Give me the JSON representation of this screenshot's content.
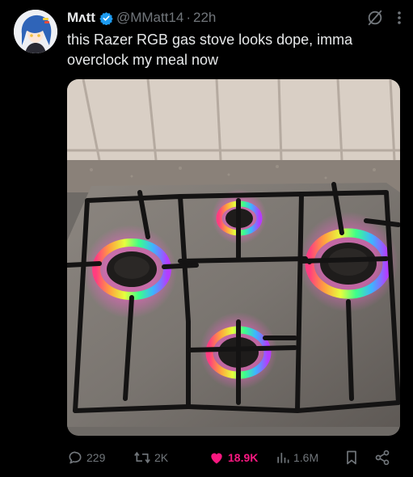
{
  "tweet": {
    "display_name": "Mʌtt",
    "handle": "@MMatt14",
    "separator": "·",
    "time": "22h",
    "text": "this Razer RGB gas stove looks dope, imma overclock my meal now"
  },
  "actions": {
    "replies": "229",
    "retweets": "2K",
    "likes": "18.9K",
    "views": "1.6M"
  },
  "colors": {
    "verified_badge": "#1d9bf0",
    "like_active": "#f91880",
    "muted_text": "#71767b"
  },
  "icons": [
    "verified-badge-icon",
    "grok-icon",
    "more-icon",
    "reply-icon",
    "retweet-icon",
    "like-icon",
    "views-icon",
    "bookmark-icon",
    "share-icon"
  ]
}
